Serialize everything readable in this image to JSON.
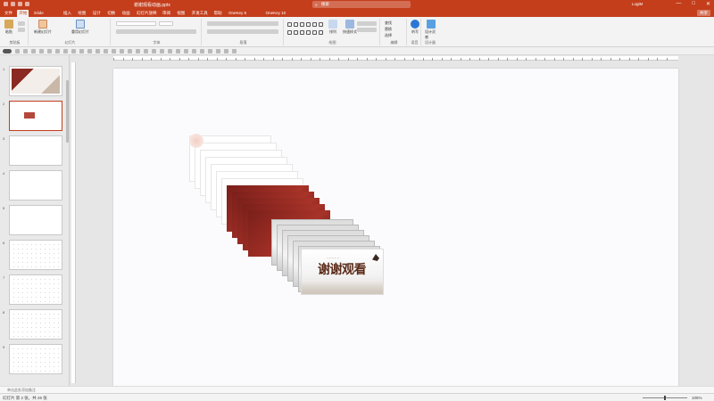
{
  "window": {
    "title": "谢谢观看动画.pptx",
    "search_placeholder": "搜索",
    "user": "LogiM",
    "minimize": "—",
    "maximize": "□",
    "close": "✕"
  },
  "tabs": [
    {
      "label": "文件",
      "active": false
    },
    {
      "label": "开始",
      "active": true
    },
    {
      "label": "iSlide",
      "active": false
    },
    {
      "label": "插入",
      "active": false
    },
    {
      "label": "绘图",
      "active": false
    },
    {
      "label": "设计",
      "active": false
    },
    {
      "label": "切换",
      "active": false
    },
    {
      "label": "动画",
      "active": false
    },
    {
      "label": "幻灯片放映",
      "active": false
    },
    {
      "label": "审阅",
      "active": false
    },
    {
      "label": "视图",
      "active": false
    },
    {
      "label": "开发工具",
      "active": false
    },
    {
      "label": "帮助",
      "active": false
    },
    {
      "label": "OneKey 8",
      "active": false
    },
    {
      "label": "OneKey 10",
      "active": false
    }
  ],
  "share_label": "共享",
  "ribbon": {
    "clipboard": {
      "paste": "粘贴",
      "label": "剪贴板"
    },
    "slides": {
      "new_slide": "新建幻灯片",
      "reuse": "重用幻灯片",
      "layout": "版式",
      "reset": "重置",
      "section": "节",
      "label": "幻灯片"
    },
    "font": {
      "label": "字体"
    },
    "paragraph": {
      "label": "段落"
    },
    "drawing": {
      "arrange": "排列",
      "quick_styles": "快速样式",
      "label": "绘图"
    },
    "editing": {
      "find": "查找",
      "replace": "替换",
      "select": "选择",
      "label": "编辑"
    },
    "voice": {
      "dictate": "听写",
      "label": "语音"
    },
    "designer": {
      "ideas": "设计灵感",
      "label": "设计器"
    }
  },
  "slide_panel": {
    "thumbs": [
      {
        "num": "1",
        "kind": "cover",
        "selected": false
      },
      {
        "num": "2",
        "kind": "small",
        "selected": true
      },
      {
        "num": "3",
        "kind": "blank",
        "selected": false
      },
      {
        "num": "4",
        "kind": "blank",
        "selected": false
      },
      {
        "num": "5",
        "kind": "blank",
        "selected": false
      },
      {
        "num": "6",
        "kind": "pattern",
        "selected": false
      },
      {
        "num": "7",
        "kind": "pattern",
        "selected": false
      },
      {
        "num": "8",
        "kind": "pattern",
        "selected": false
      },
      {
        "num": "9",
        "kind": "pattern",
        "selected": false
      }
    ]
  },
  "final_card": {
    "topline": "··········",
    "thanks": "谢谢观看"
  },
  "status": {
    "left": "幻灯片 第 2 张，共 26 张",
    "notes": "单击此处添加备注",
    "zoom": "105%"
  },
  "colors": {
    "accent": "#c43e1c",
    "card_red": "#a83329"
  }
}
